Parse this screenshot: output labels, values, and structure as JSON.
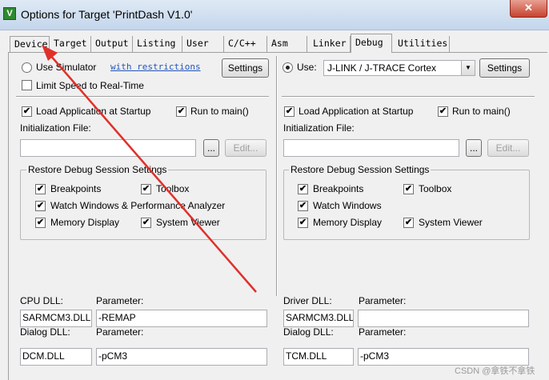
{
  "window": {
    "title": "Options for Target 'PrintDash V1.0'",
    "app_icon": "V",
    "close": "✕"
  },
  "tabs": [
    {
      "label": "Device"
    },
    {
      "label": "Target"
    },
    {
      "label": "Output"
    },
    {
      "label": "Listing"
    },
    {
      "label": "User"
    },
    {
      "label": "C/C++"
    },
    {
      "label": "Asm"
    },
    {
      "label": "Linker"
    },
    {
      "label": "Debug",
      "active": true
    },
    {
      "label": "Utilities"
    }
  ],
  "left": {
    "use_simulator": "Use Simulator",
    "with_restrictions": "with restrictions",
    "settings": "Settings",
    "limit_speed": "Limit Speed to Real-Time",
    "load_app": "Load Application at Startup",
    "run_to_main": "Run to main()",
    "init_file_label": "Initialization File:",
    "browse": "...",
    "edit": "Edit...",
    "restore_group": "Restore Debug Session Settings",
    "breakpoints": "Breakpoints",
    "toolbox": "Toolbox",
    "watch_windows": "Watch Windows & Performance Analyzer",
    "memory_display": "Memory Display",
    "system_viewer": "System Viewer",
    "dll_label": "CPU DLL:",
    "param_label": "Parameter:",
    "dll_value": "SARMCM3.DLL",
    "param_value": "-REMAP",
    "dialog_dll_label": "Dialog DLL:",
    "dialog_param_label": "Parameter:",
    "dialog_dll_value": "DCM.DLL",
    "dialog_param_value": "-pCM3"
  },
  "right": {
    "use": "Use:",
    "driver": "J-LINK / J-TRACE Cortex",
    "settings": "Settings",
    "load_app": "Load Application at Startup",
    "run_to_main": "Run to main()",
    "init_file_label": "Initialization File:",
    "browse": "...",
    "edit": "Edit...",
    "restore_group": "Restore Debug Session Settings",
    "breakpoints": "Breakpoints",
    "toolbox": "Toolbox",
    "watch_windows": "Watch Windows",
    "memory_display": "Memory Display",
    "system_viewer": "System Viewer",
    "dll_label": "Driver DLL:",
    "param_label": "Parameter:",
    "dll_value": "SARMCM3.DLL",
    "param_value": "",
    "dialog_dll_label": "Dialog DLL:",
    "dialog_param_label": "Parameter:",
    "dialog_dll_value": "TCM.DLL",
    "dialog_param_value": "-pCM3"
  },
  "check": "✔",
  "dropdown_arrow": "▼",
  "watermark": "CSDN @拿铁不拿铁",
  "colors": {
    "arrow": "#e0302a",
    "link": "#2255bb"
  }
}
